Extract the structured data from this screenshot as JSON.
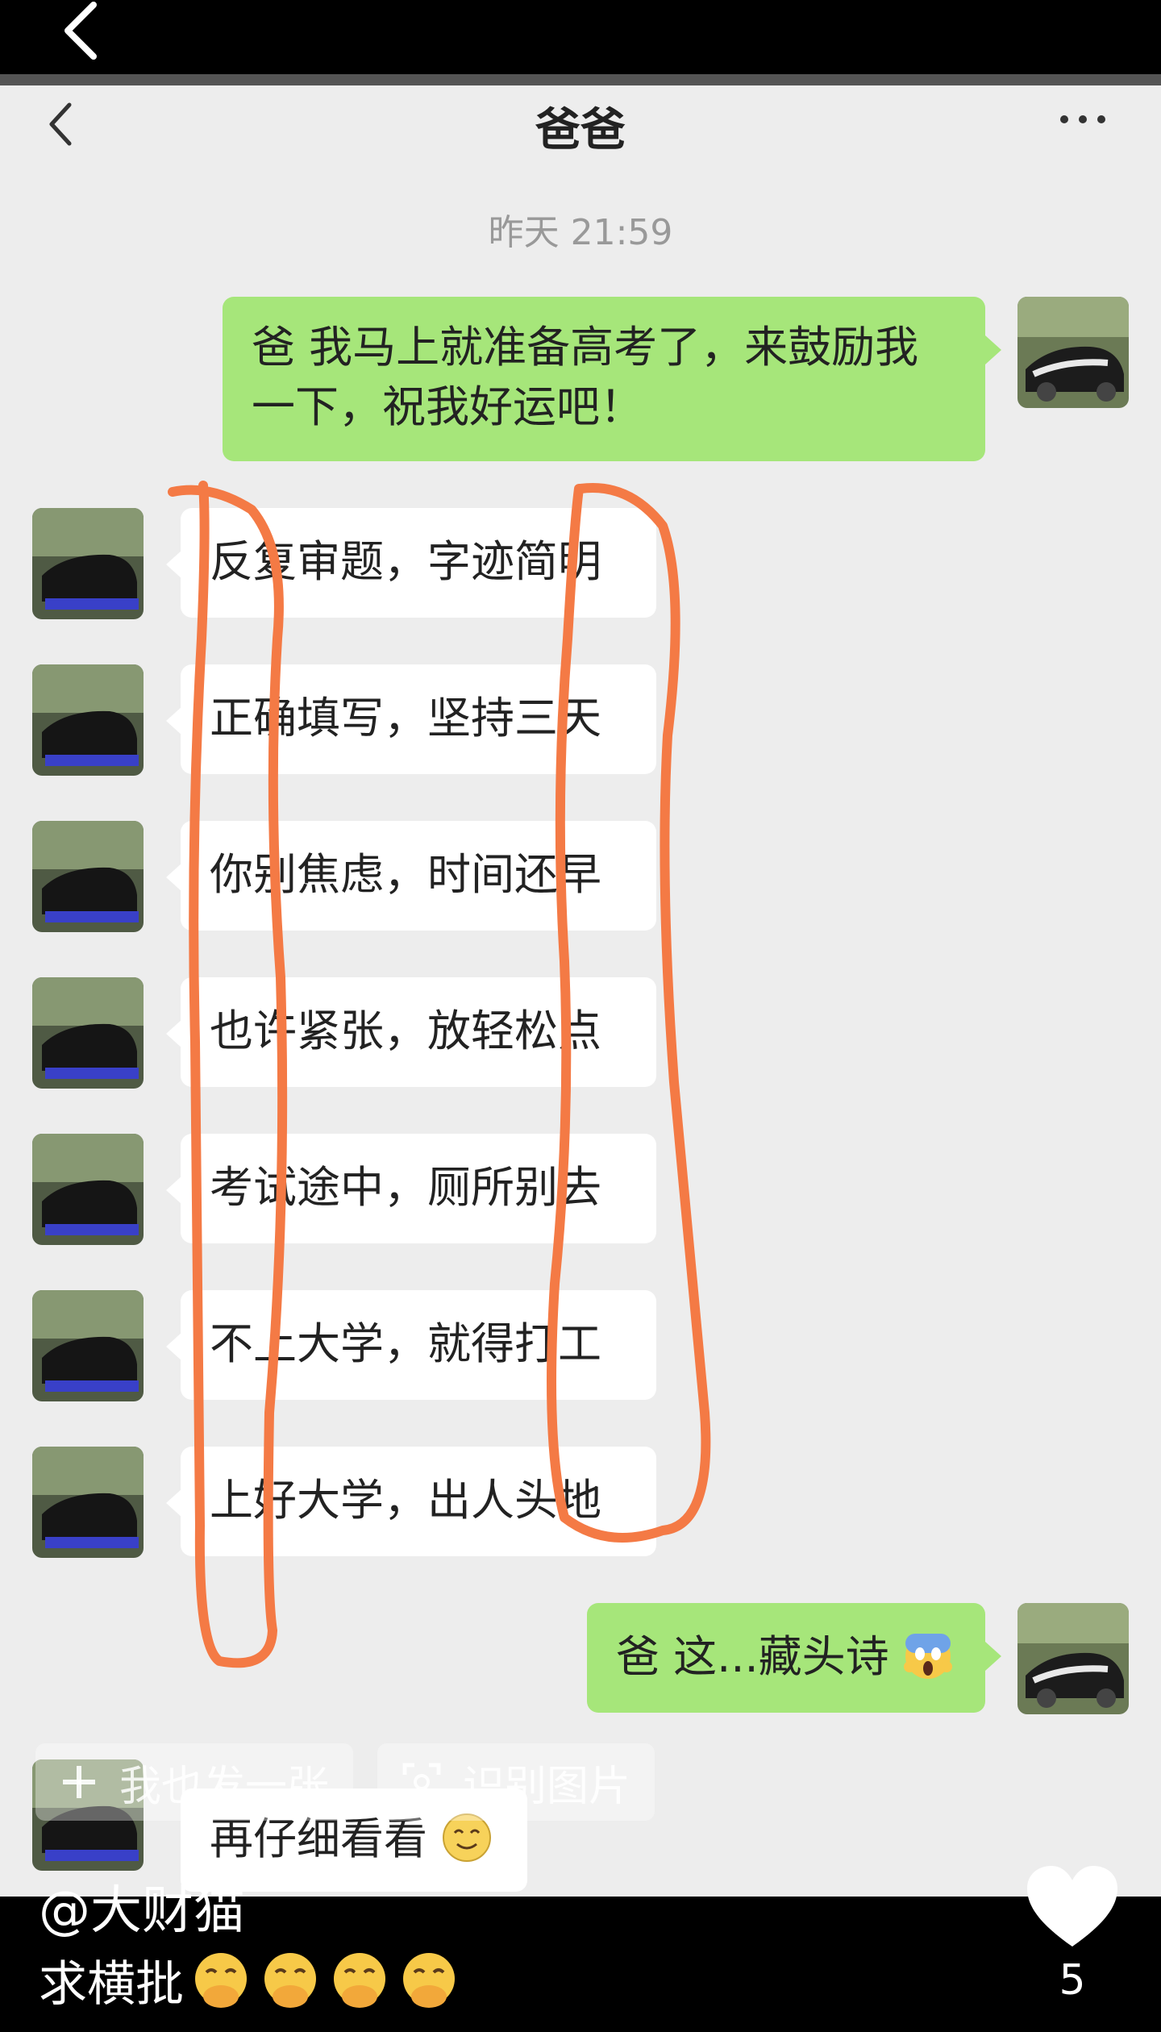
{
  "chat": {
    "title": "爸爸",
    "timestamp": "昨天 21:59",
    "messages": [
      {
        "side": "sent",
        "lines": [
          "爸 我马上就准备高考了，来鼓励我",
          "一下，祝我好运吧！"
        ]
      },
      {
        "side": "recv",
        "text": "反复审题，字迹简明"
      },
      {
        "side": "recv",
        "text": "正确填写，坚持三天"
      },
      {
        "side": "recv",
        "text": "你别焦虑，时间还早"
      },
      {
        "side": "recv",
        "text": "也许紧张，放轻松点"
      },
      {
        "side": "recv",
        "text": "考试途中，厕所别去"
      },
      {
        "side": "recv",
        "text": "不上大学，就得打工"
      },
      {
        "side": "recv",
        "text": "上好大学，出人头地"
      },
      {
        "side": "sent",
        "text": "爸 这...藏头诗",
        "emoji": "scream-emoji"
      },
      {
        "side": "recv",
        "text": "再仔细看看",
        "emoji": "smile-emoji"
      }
    ]
  },
  "overlay": {
    "post_same_label": "我也发一张",
    "recognize_label": "识别图片"
  },
  "post": {
    "author": "@大财猫",
    "caption": "求横批",
    "caption_emoji": "hand-over-mouth-emoji",
    "caption_emoji_count": 4,
    "like_count": "5"
  },
  "annotation": {
    "type": "orange hand-drawn loops around first and last characters",
    "color": "#f47a45"
  }
}
